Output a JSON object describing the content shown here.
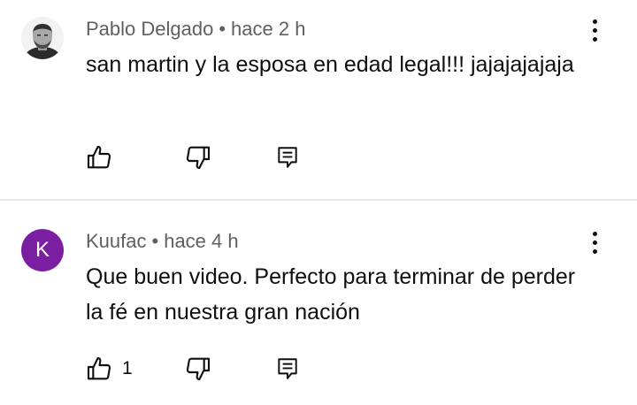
{
  "comments": [
    {
      "author": "Pablo Delgado",
      "separator": "•",
      "time": "hace 2 h",
      "text": "san martin y la esposa en edad legal!!! jajajajajaja",
      "like_count": "",
      "avatar_icon": "user-photo-avatar"
    },
    {
      "author": "Kuufac",
      "separator": "•",
      "time": "hace 4 h",
      "text": "Que buen video. Perfecto para terminar de perder la fé en nuestra gran nación",
      "like_count": "1",
      "avatar_letter": "K",
      "avatar_color": "#7b1fa2"
    }
  ],
  "icons": {
    "like": "thumb-up-icon",
    "dislike": "thumb-down-icon",
    "reply": "comment-reply-icon",
    "more": "more-vertical-icon"
  }
}
